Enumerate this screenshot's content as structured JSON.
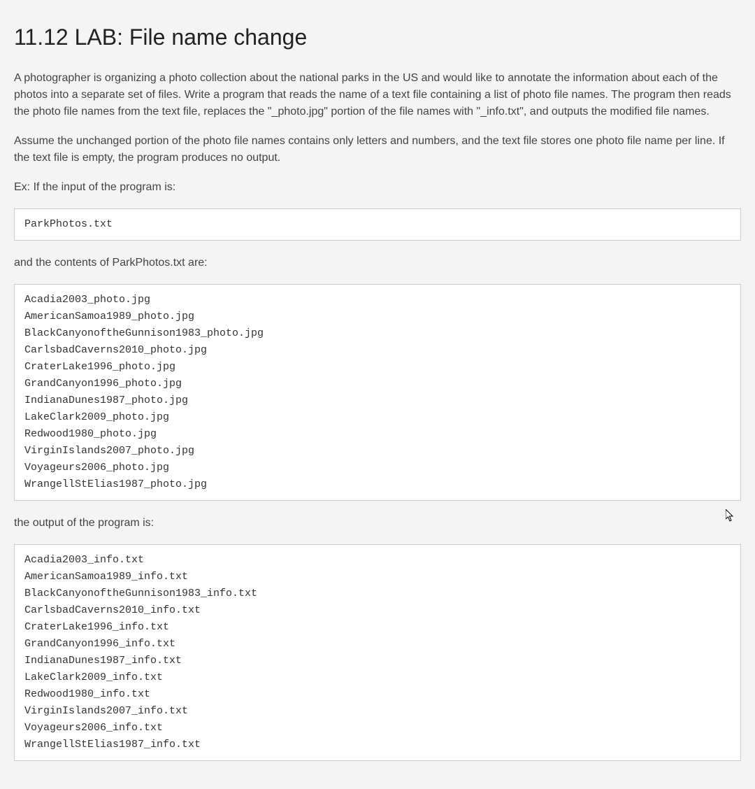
{
  "title": "11.12 LAB: File name change",
  "paragraphs": {
    "p1": "A photographer is organizing a photo collection about the national parks in the US and would like to annotate the information about each of the photos into a separate set of files. Write a program that reads the name of a text file containing a list of photo file names. The program then reads the photo file names from the text file, replaces the \"_photo.jpg\" portion of the file names with \"_info.txt\", and outputs the modified file names.",
    "p2": "Assume the unchanged portion of the photo file names contains only letters and numbers, and the text file stores one photo file name per line. If the text file is empty, the program produces no output.",
    "p3": "Ex: If the input of the program is:",
    "p4": "and the contents of ParkPhotos.txt are:",
    "p5": "the output of the program is:"
  },
  "code": {
    "input": "ParkPhotos.txt",
    "contents": "Acadia2003_photo.jpg\nAmericanSamoa1989_photo.jpg\nBlackCanyonoftheGunnison1983_photo.jpg\nCarlsbadCaverns2010_photo.jpg\nCraterLake1996_photo.jpg\nGrandCanyon1996_photo.jpg\nIndianaDunes1987_photo.jpg\nLakeClark2009_photo.jpg\nRedwood1980_photo.jpg\nVirginIslands2007_photo.jpg\nVoyageurs2006_photo.jpg\nWrangellStElias1987_photo.jpg",
    "output": "Acadia2003_info.txt\nAmericanSamoa1989_info.txt\nBlackCanyonoftheGunnison1983_info.txt\nCarlsbadCaverns2010_info.txt\nCraterLake1996_info.txt\nGrandCanyon1996_info.txt\nIndianaDunes1987_info.txt\nLakeClark2009_info.txt\nRedwood1980_info.txt\nVirginIslands2007_info.txt\nVoyageurs2006_info.txt\nWrangellStElias1987_info.txt"
  }
}
